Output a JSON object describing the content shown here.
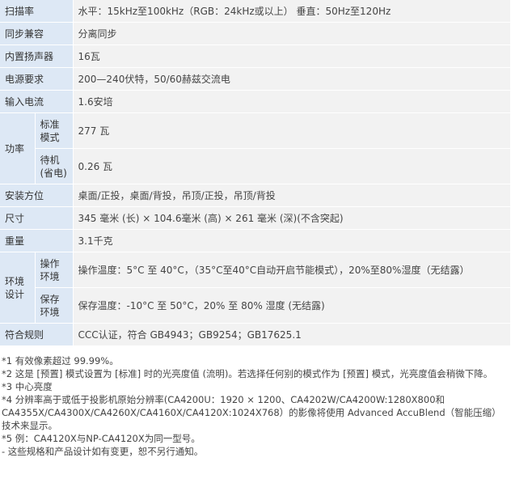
{
  "rows": [
    {
      "label": "扫描率",
      "value": "水平：15kHz至100kHz（RGB：24kHz或以上） 垂直：50Hz至120Hz"
    },
    {
      "label": "同步兼容",
      "value": "分离同步"
    },
    {
      "label": "内置扬声器",
      "value": "16瓦"
    },
    {
      "label": "电源要求",
      "value": "200—240伏特，50/60赫兹交流电"
    },
    {
      "label": "输入电流",
      "value": "1.6安培"
    },
    {
      "label": "功率",
      "sub": [
        {
          "label": "标准模式",
          "value": "277 瓦"
        },
        {
          "label": "待机(省电)",
          "value": "0.26 瓦"
        }
      ]
    },
    {
      "label": "安装方位",
      "value": "桌面/正投，桌面/背投，吊顶/正投，吊顶/背投"
    },
    {
      "label": "尺寸",
      "value": "345 毫米 (长) × 104.6毫米 (高) × 261 毫米 (深)(不含突起)"
    },
    {
      "label": "重量",
      "value": "3.1千克"
    },
    {
      "label": "环境设计",
      "sub": [
        {
          "label": "操作环境",
          "value": "操作温度：5°C 至 40°C，（35°C至40°C自动开启节能模式），20%至80%湿度（无结露）"
        },
        {
          "label": "保存环境",
          "value": "保存温度：-10°C 至 50°C，20% 至 80% 湿度 (无结露)"
        }
      ]
    },
    {
      "label": "符合规则",
      "value": "CCC认证，符合 GB4943；GB9254；GB17625.1"
    }
  ],
  "notes": [
    "*1 有效像素超过 99.99%。",
    "*2 这是 [预置] 模式设置为 [标准] 时的光亮度值 (流明)。若选择任何别的模式作为 [预置] 模式，光亮度值会稍微下降。",
    "*3 中心亮度",
    "*4 分辨率高于或低于投影机原始分辨率(CA4200U：1920 × 1200、CA4202W/CA4200W:1280X800和CA4355X/CA4300X/CA4260X/CA4160X/CA4120X:1024X768）的影像将使用 Advanced AccuBlend（智能压缩）技术来显示。",
    "*5 例：CA4120X与NP-CA4120X为同一型号。",
    "- 这些规格和产品设计如有变更，恕不另行通知。"
  ]
}
